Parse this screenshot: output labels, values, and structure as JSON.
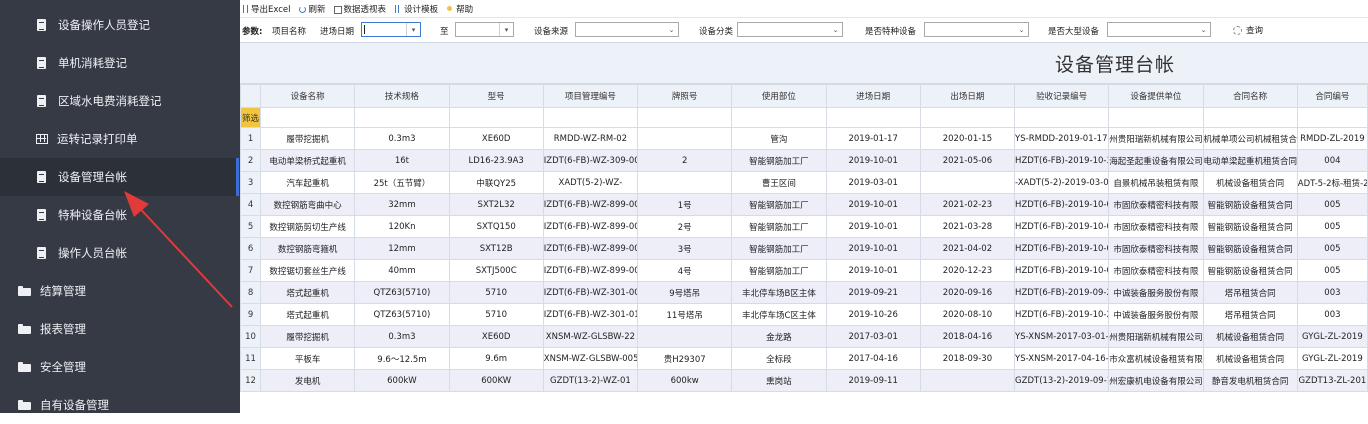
{
  "sidebar": {
    "items": [
      {
        "label": "设备操作人员登记",
        "icon": "document-icon",
        "level": "sub"
      },
      {
        "label": "单机消耗登记",
        "icon": "document-icon",
        "level": "sub"
      },
      {
        "label": "区域水电费消耗登记",
        "icon": "document-icon",
        "level": "sub"
      },
      {
        "label": "运转记录打印单",
        "icon": "grid-icon",
        "level": "sub"
      },
      {
        "label": "设备管理台帐",
        "icon": "document-icon",
        "level": "sub",
        "active": true
      },
      {
        "label": "特种设备台帐",
        "icon": "document-icon",
        "level": "sub"
      },
      {
        "label": "操作人员台帐",
        "icon": "document-icon",
        "level": "sub"
      },
      {
        "label": "结算管理",
        "icon": "folder-icon",
        "level": "top"
      },
      {
        "label": "报表管理",
        "icon": "folder-icon",
        "level": "top"
      },
      {
        "label": "安全管理",
        "icon": "folder-icon",
        "level": "top"
      },
      {
        "label": "自有设备管理",
        "icon": "folder-icon",
        "level": "top"
      }
    ]
  },
  "toolbar": {
    "export_excel": "导出Excel",
    "refresh": "刷新",
    "pivot": "数据透视表",
    "design": "设计模板",
    "help": "帮助"
  },
  "params": {
    "label": "参数:",
    "project_name": "项目名称",
    "entry_date": "进场日期",
    "to": "至",
    "device_source": "设备来源",
    "device_category": "设备分类",
    "is_special": "是否特种设备",
    "is_large": "是否大型设备",
    "query": "查询"
  },
  "report": {
    "title": "设备管理台帐",
    "columns": [
      "设备名称",
      "技术规格",
      "型号",
      "项目管理编号",
      "牌照号",
      "使用部位",
      "进场日期",
      "出场日期",
      "验收记录编号",
      "设备提供单位",
      "合同名称",
      "合同编号"
    ],
    "filter_label": "筛选",
    "rows": [
      [
        "1",
        "履带挖掘机",
        "0.3m3",
        "XE60D",
        "RMDD-WZ-RM-02",
        "",
        "管沟",
        "2019-01-17",
        "2020-01-15",
        "YS-RMDD-2019-01-17-0",
        "州贵阳瑞新机械有限公司",
        "机械单项公司机械租赁合",
        "RMDD-ZL-2019"
      ],
      [
        "2",
        "电动单梁桥式起重机",
        "16t",
        "LD16-23.9A3",
        "IZDT(6-FB)-WZ-309-00",
        "2",
        "智能钢筋加工厂",
        "2019-10-01",
        "2021-05-06",
        "HZDT(6-FB)-2019-10-3",
        "海起圣起重设备有限公司",
        "电动单梁起重机租赁合同",
        "004"
      ],
      [
        "3",
        "汽车起重机",
        "25t（五节臂）",
        "中联QY25",
        "XADT(5-2)-WZ-",
        "",
        "曹王区间",
        "2019-03-01",
        "",
        "-XADT(5-2)-2019-03-0",
        "自景机械吊装租赁有限",
        "机械设备租赁合同",
        "ADT-5-2标-租赁-2"
      ],
      [
        "4",
        "数控钢筋弯曲中心",
        "32mm",
        "SXT2L32",
        "IZDT(6-FB)-WZ-899-00",
        "1号",
        "智能钢筋加工厂",
        "2019-10-01",
        "2021-02-23",
        "HZDT(6-FB)-2019-10-0",
        "市固欣泰精密科技有限",
        "智能钢筋设备租赁合同",
        "005"
      ],
      [
        "5",
        "数控钢筋剪切生产线",
        "120Kn",
        "SXTQ150",
        "IZDT(6-FB)-WZ-899-00",
        "2号",
        "智能钢筋加工厂",
        "2019-10-01",
        "2021-03-28",
        "HZDT(6-FB)-2019-10-0",
        "市固欣泰精密科技有限",
        "智能钢筋设备租赁合同",
        "005"
      ],
      [
        "6",
        "数控钢筋弯箍机",
        "12mm",
        "SXT12B",
        "IZDT(6-FB)-WZ-899-00",
        "3号",
        "智能钢筋加工厂",
        "2019-10-01",
        "2021-04-02",
        "HZDT(6-FB)-2019-10-0",
        "市固欣泰精密科技有限",
        "智能钢筋设备租赁合同",
        "005"
      ],
      [
        "7",
        "数控锯切套丝生产线",
        "40mm",
        "SXTJ500C",
        "IZDT(6-FB)-WZ-899-00",
        "4号",
        "智能钢筋加工厂",
        "2019-10-01",
        "2020-12-23",
        "HZDT(6-FB)-2019-10-0",
        "市固欣泰精密科技有限",
        "智能钢筋设备租赁合同",
        "005"
      ],
      [
        "8",
        "塔式起重机",
        "QTZ63(5710)",
        "5710",
        "IZDT(6-FB)-WZ-301-00",
        "9号塔吊",
        "丰北停车场B区主体",
        "2019-09-21",
        "2020-09-16",
        "HZDT(6-FB)-2019-09-2",
        "中诚装备服务股份有限",
        "塔吊租赁合同",
        "003"
      ],
      [
        "9",
        "塔式起重机",
        "QTZ63(5710)",
        "5710",
        "IZDT(6-FB)-WZ-301-01",
        "11号塔吊",
        "丰北停车场C区主体",
        "2019-10-26",
        "2020-08-10",
        "HZDT(6-FB)-2019-10-2",
        "中诚装备服务股份有限",
        "塔吊租赁合同",
        "003"
      ],
      [
        "10",
        "履带挖掘机",
        "0.3m3",
        "XE60D",
        "XNSM-WZ-GLSBW-22",
        "",
        "金龙路",
        "2017-03-01",
        "2018-04-16",
        "YS-XNSM-2017-03-01-0",
        "州贵阳瑞新机械有限公司",
        "机械设备租赁合同",
        "GYGL-ZL-2019"
      ],
      [
        "11",
        "平板车",
        "9.6～12.5m",
        "9.6m",
        "XNSM-WZ-GLSBW-005",
        "贵H29307",
        "全标段",
        "2017-04-16",
        "2018-09-30",
        "YS-XNSM-2017-04-16-0",
        "市众富机械设备租赁有限",
        "机械设备租赁合同",
        "GYGL-ZL-2019"
      ],
      [
        "12",
        "发电机",
        "600kW",
        "600KW",
        "GZDT(13-2)-WZ-01",
        "600kw",
        "熏岗站",
        "2019-09-11",
        "",
        "GZDT(13-2)-2019-09-1",
        "州宏康机电设备有限公司",
        "静音发电机租赁合同",
        "GZDT13-ZL-201"
      ]
    ]
  },
  "colors": {
    "sidebar_bg": "#353a45",
    "active_indicator": "#3b6dd8",
    "header_bg": "#edf1f8",
    "filter_highlight": "#f3c53f",
    "arrow": "#e03a3a"
  }
}
